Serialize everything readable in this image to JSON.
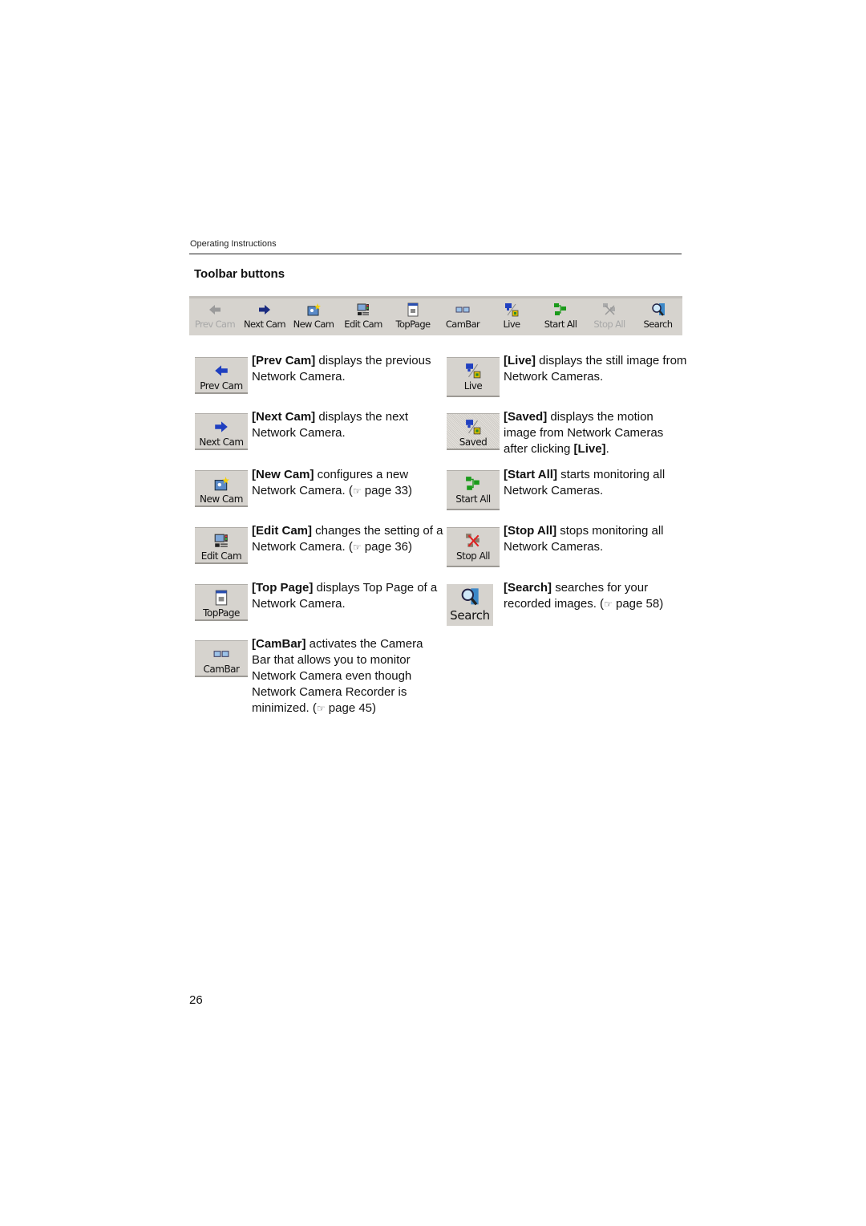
{
  "header": {
    "label": "Operating Instructions"
  },
  "section_title": "Toolbar buttons",
  "toolbar": {
    "buttons": [
      {
        "label": "Prev Cam",
        "icon": "left-arrow-icon",
        "enabled": false
      },
      {
        "label": "Next Cam",
        "icon": "right-arrow-icon",
        "enabled": true
      },
      {
        "label": "New Cam",
        "icon": "new-camera-icon",
        "enabled": true
      },
      {
        "label": "Edit Cam",
        "icon": "edit-camera-icon",
        "enabled": true
      },
      {
        "label": "TopPage",
        "icon": "top-page-icon",
        "enabled": true
      },
      {
        "label": "CamBar",
        "icon": "cambar-icon",
        "enabled": true
      },
      {
        "label": "Live",
        "icon": "live-camera-icon",
        "enabled": true
      },
      {
        "label": "Start All",
        "icon": "start-all-icon",
        "enabled": true
      },
      {
        "label": "Stop All",
        "icon": "stop-all-icon",
        "enabled": false
      },
      {
        "label": "Search",
        "icon": "search-magnifier-icon",
        "enabled": true
      }
    ]
  },
  "entries_left": [
    {
      "button": "Prev Cam",
      "name": "[Prev Cam]",
      "text": " displays the previous Network Camera.",
      "page_ref": ""
    },
    {
      "button": "Next Cam",
      "name": "[Next Cam]",
      "text": " displays the next Network Camera.",
      "page_ref": ""
    },
    {
      "button": "New Cam",
      "name": "[New Cam]",
      "text": " configures a new Network Camera. (",
      "page_ref": "page 33)"
    },
    {
      "button": "Edit Cam",
      "name": "[Edit Cam]",
      "text": " changes the setting of a Network Camera. (",
      "page_ref": "page 36)"
    },
    {
      "button": "TopPage",
      "name": "[Top Page]",
      "text": " displays Top Page of a Network Camera.",
      "page_ref": ""
    },
    {
      "button": "CamBar",
      "name": "[CamBar]",
      "text": " activates the Camera Bar that allows you to monitor Network Camera even though Network Camera Recorder is minimized. (",
      "page_ref": "page 45)"
    }
  ],
  "entries_right": [
    {
      "button": "Live",
      "name": "[Live]",
      "text": " displays the still image from Network Cameras.",
      "page_ref": ""
    },
    {
      "button": "Saved",
      "name": "[Saved]",
      "text": " displays the motion image from Network Cameras after clicking ",
      "bold_tail": "[Live]",
      "tail": "."
    },
    {
      "button": "Start All",
      "name": "[Start All]",
      "text": " starts monitoring all Network Cameras.",
      "page_ref": ""
    },
    {
      "button": "Stop All",
      "name": "[Stop All]",
      "text": " stops monitoring all Network Cameras.",
      "page_ref": ""
    },
    {
      "button": "Search",
      "name": "[Search]",
      "text": " searches for your recorded images. (",
      "page_ref": "page 58)"
    }
  ],
  "reference_icon": "pointing-hand-icon",
  "page_number": "26",
  "colors": {
    "button_face": "#d6d3ce",
    "arrow_blue": "#1f3fc0",
    "camera_green": "#1a9a1a",
    "stop_red": "#e02020"
  }
}
